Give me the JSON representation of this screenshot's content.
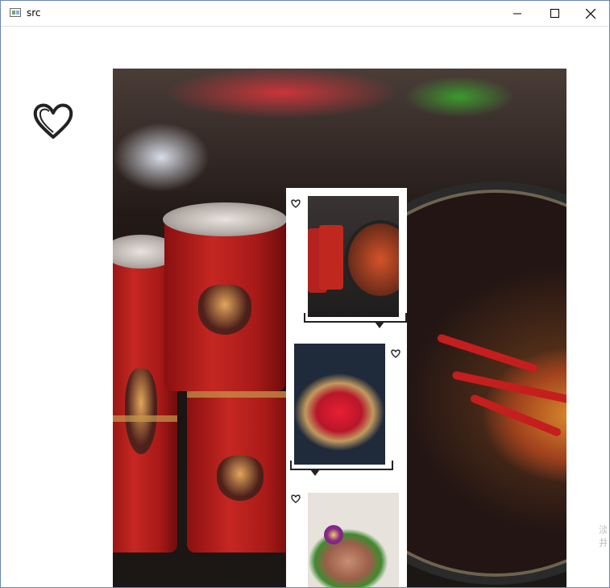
{
  "window": {
    "title": "src",
    "icons": {
      "app": "app-window-icon",
      "minimize": "minimize-icon",
      "maximize": "maximize-icon",
      "close": "close-icon"
    }
  },
  "canvas": {
    "decor": {
      "heart": "heart-icon"
    },
    "watermark_text": "淡 井"
  },
  "colors": {
    "window_border": "#6b87b5",
    "sauce_red": "#c41e1e",
    "can_red": "#c52722"
  }
}
